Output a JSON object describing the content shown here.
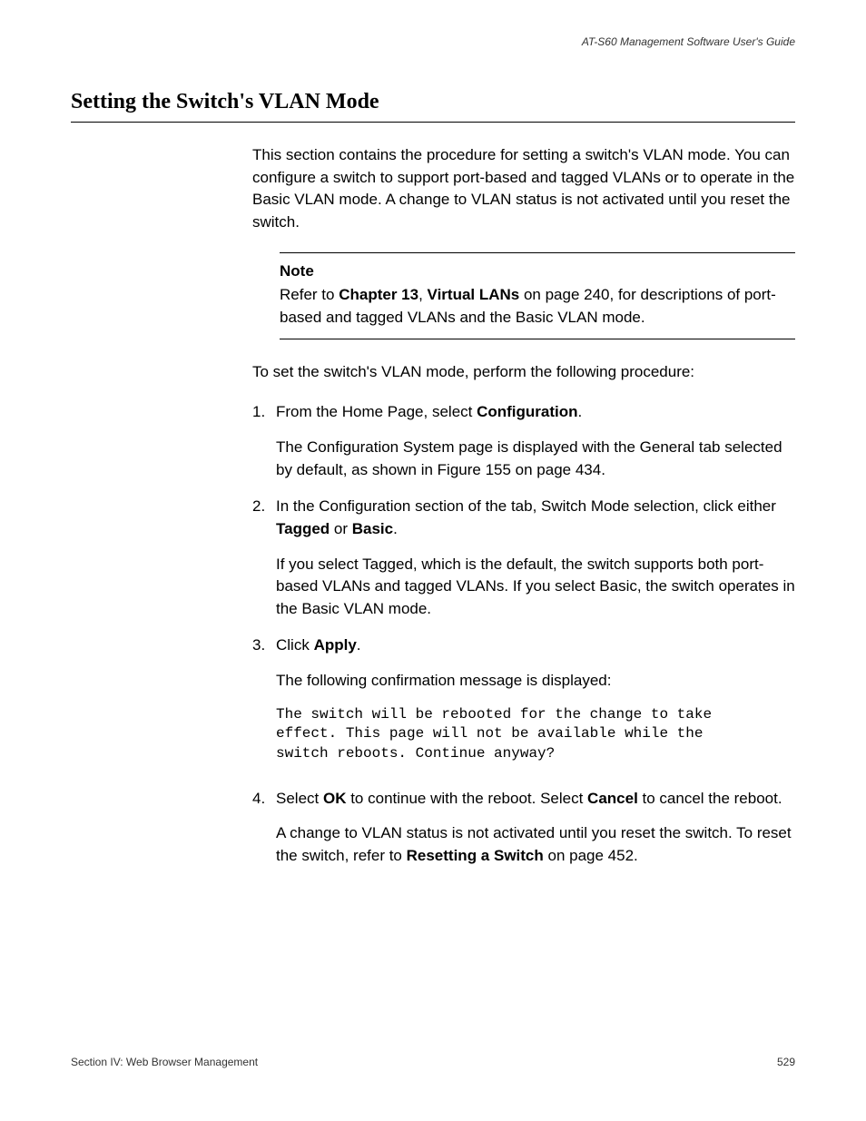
{
  "header": {
    "guide_title": "AT-S60 Management Software User's Guide"
  },
  "section": {
    "title": "Setting the Switch's VLAN Mode",
    "intro": "This section contains the procedure for setting a switch's VLAN mode. You can configure a switch to support port-based and tagged VLANs or to operate in the Basic VLAN mode. A change to VLAN status is not activated until you reset the switch.",
    "note_label": "Note",
    "note_prefix": "Refer to ",
    "note_bold1": "Chapter 13",
    "note_sep": ", ",
    "note_bold2": "Virtual LANs",
    "note_suffix": " on page 240, for descriptions of port-based and tagged VLANs and the Basic VLAN mode.",
    "lead_in": "To set the switch's VLAN mode, perform the following procedure:",
    "steps": {
      "s1_num": "1.",
      "s1_a_pre": "From the Home Page, select ",
      "s1_a_bold": "Configuration",
      "s1_a_post": ".",
      "s1_b": "The Configuration System page is displayed with the General tab selected by default, as shown in Figure 155 on page 434.",
      "s2_num": "2.",
      "s2_a_pre": "In the Configuration section of the tab, Switch Mode selection, click either ",
      "s2_a_bold1": "Tagged",
      "s2_a_mid": " or ",
      "s2_a_bold2": "Basic",
      "s2_a_post": ".",
      "s2_b": "If you select Tagged, which is the default, the switch supports both port-based VLANs and tagged VLANs. If you select Basic, the switch operates in the Basic VLAN mode.",
      "s3_num": "3.",
      "s3_a_pre": "Click ",
      "s3_a_bold": "Apply",
      "s3_a_post": ".",
      "s3_b": "The following confirmation message is displayed:",
      "s3_code": "The switch will be rebooted for the change to take\neffect. This page will not be available while the\nswitch reboots. Continue anyway?",
      "s4_num": "4.",
      "s4_a_pre": "Select ",
      "s4_a_bold1": "OK",
      "s4_a_mid": " to continue with the reboot. Select ",
      "s4_a_bold2": "Cancel",
      "s4_a_post": " to cancel the reboot.",
      "s4_b_pre": "A change to VLAN status is not activated until you reset the switch. To reset the switch, refer to ",
      "s4_b_bold": "Resetting a Switch",
      "s4_b_post": " on page 452."
    }
  },
  "footer": {
    "section_label": "Section IV: Web Browser Management",
    "page_number": "529"
  }
}
